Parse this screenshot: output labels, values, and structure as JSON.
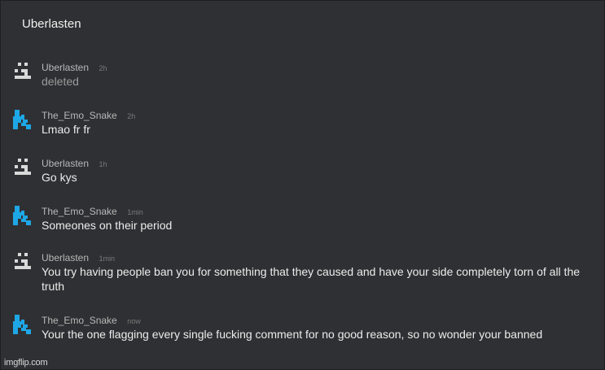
{
  "thread": {
    "title": "Uberlasten"
  },
  "colors": {
    "uberlasten_avatar": "#d9d9d9",
    "emo_snake_avatar": "#1ea7e6"
  },
  "comments": [
    {
      "user": "Uberlasten",
      "time": "2h",
      "text": "deleted",
      "avatar": "pixel-face-icon"
    },
    {
      "user": "The_Emo_Snake",
      "time": "2h",
      "text": "Lmao fr fr",
      "avatar": "pixel-snake-icon"
    },
    {
      "user": "Uberlasten",
      "time": "1h",
      "text": "Go kys",
      "avatar": "pixel-face-icon"
    },
    {
      "user": "The_Emo_Snake",
      "time": "1min",
      "text": "Someones on their period",
      "avatar": "pixel-snake-icon"
    },
    {
      "user": "Uberlasten",
      "time": "1min",
      "text": "You try having people ban you for something that they caused and have your side completely torn of all the truth",
      "avatar": "pixel-face-icon"
    },
    {
      "user": "The_Emo_Snake",
      "time": "now",
      "text": "Your the one flagging every single fucking comment for no good reason, so no wonder your banned",
      "avatar": "pixel-snake-icon"
    }
  ],
  "watermark": "imgflip.com"
}
